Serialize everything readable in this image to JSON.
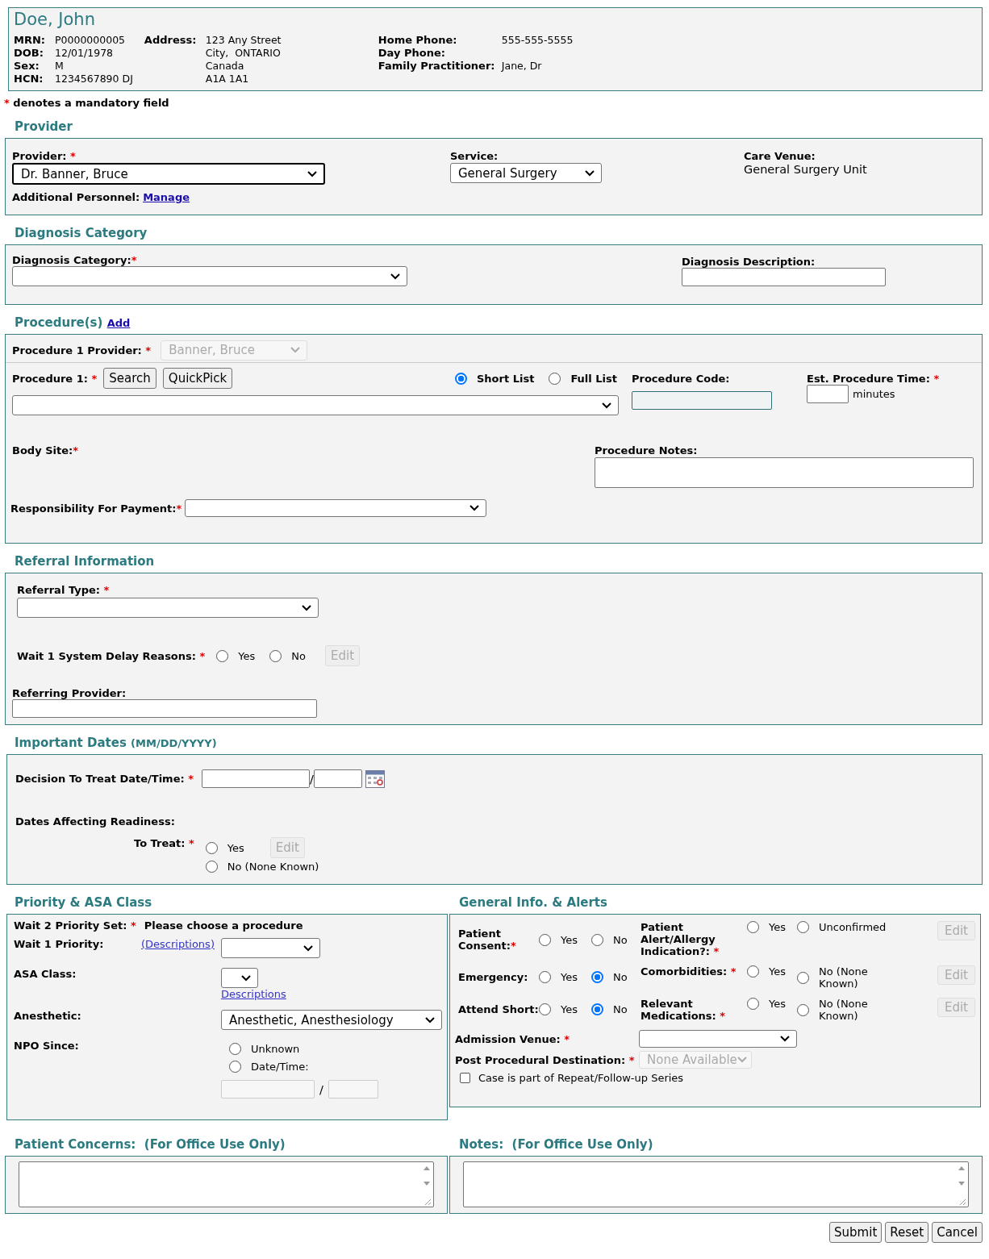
{
  "patient": {
    "name": "Doe, John",
    "left": [
      {
        "label": "MRN:",
        "value": "P0000000005"
      },
      {
        "label": "DOB:",
        "value": "12/01/1978"
      },
      {
        "label": "Sex:",
        "value": "M"
      },
      {
        "label": "HCN:",
        "value": "1234567890 DJ"
      }
    ],
    "address": {
      "label": "Address:",
      "lines": [
        "123 Any Street",
        "City,  ONTARIO",
        "Canada",
        "A1A 1A1"
      ]
    },
    "right": [
      {
        "label": "Home Phone:",
        "value": "555-555-5555"
      },
      {
        "label": "Day Phone:"
      },
      {
        "label": "Family Practitioner:",
        "value": "Jane, Dr"
      }
    ]
  },
  "legend": {
    "mark": "*",
    "text": "denotes a mandatory field"
  },
  "provider": {
    "title": "Provider",
    "provider": {
      "label": "Provider:",
      "mark": "*",
      "value": "Dr. Banner, Bruce"
    },
    "service": {
      "label": "Service:",
      "value": "General Surgery"
    },
    "care_venue": {
      "label": "Care Venue:",
      "value": "General Surgery Unit"
    },
    "personnel": {
      "label": "Additional Personnel:",
      "link": "Manage"
    }
  },
  "diagnosis": {
    "title": "Diagnosis Category",
    "category": {
      "label": "Diagnosis Category:",
      "mark": "*"
    },
    "description": {
      "label": "Diagnosis Description:"
    }
  },
  "procedures": {
    "title": "Procedure(s)",
    "add_link": "Add",
    "provider": {
      "label": "Procedure 1 Provider:",
      "mark": "*",
      "value": "Banner, Bruce",
      "disabled": true
    },
    "procedure": {
      "label": "Procedure 1:",
      "mark": "*",
      "buttons": [
        "Search",
        "QuickPick"
      ]
    },
    "list_options": [
      {
        "label": "Short List",
        "selected": true
      },
      {
        "label": "Full List",
        "selected": false
      }
    ],
    "code": {
      "label": "Procedure Code:"
    },
    "time": {
      "label": "Est. Procedure Time:",
      "mark": "*",
      "unit": "minutes"
    },
    "body_site": {
      "label": "Body Site:",
      "mark": "*"
    },
    "notes": {
      "label": "Procedure Notes:"
    },
    "payment": {
      "label": "Responsibility For Payment:",
      "mark": "*"
    }
  },
  "referral": {
    "title": "Referral Information",
    "type": {
      "label": "Referral Type:",
      "mark": "*"
    },
    "delay": {
      "label": "Wait 1 System Delay Reasons:",
      "mark": "*",
      "options": [
        {
          "label": "Yes",
          "selected": false
        },
        {
          "label": "No",
          "selected": false
        }
      ],
      "button": {
        "label": "Edit",
        "disabled": true
      }
    },
    "referring": {
      "label": "Referring Provider:"
    }
  },
  "dates": {
    "title": "Important Dates",
    "title_note": "(MM/DD/YYYY)",
    "decision": {
      "label": "Decision To Treat Date/Time:",
      "mark": "*",
      "separator": "/"
    },
    "readiness": {
      "label": "Dates Affecting Readiness:"
    },
    "to_treat": {
      "label": "To Treat:",
      "mark": "*",
      "options": [
        {
          "label": "Yes",
          "selected": false
        },
        {
          "label": "No (None Known)",
          "selected": false
        }
      ],
      "button": {
        "label": "Edit",
        "disabled": true
      }
    }
  },
  "priority": {
    "title": "Priority & ASA Class",
    "wait2": {
      "label": "Wait 2 Priority Set:",
      "mark": "*",
      "value": "Please choose a procedure"
    },
    "wait1": {
      "label": "Wait 1 Priority:",
      "link": "(Descriptions)"
    },
    "asa": {
      "label": "ASA Class:",
      "link": "Descriptions"
    },
    "anesthetic": {
      "label": "Anesthetic:",
      "value": "Anesthetic, Anesthesiology"
    },
    "npo": {
      "label": "NPO Since:",
      "options": [
        {
          "label": "Unknown",
          "selected": false
        },
        {
          "label": "Date/Time:",
          "selected": false
        }
      ],
      "separator": "/"
    }
  },
  "general": {
    "title": "General Info. & Alerts",
    "left": [
      {
        "label": "Patient Consent:",
        "mark": "*",
        "options": [
          {
            "label": "Yes",
            "selected": false
          },
          {
            "label": "No",
            "selected": false
          }
        ]
      },
      {
        "label": "Emergency:",
        "options": [
          {
            "label": "Yes",
            "selected": false
          },
          {
            "label": "No",
            "selected": true
          }
        ]
      },
      {
        "label": "Attend Short:",
        "options": [
          {
            "label": "Yes",
            "selected": false
          },
          {
            "label": "No",
            "selected": true
          }
        ]
      }
    ],
    "right": [
      {
        "label": "Patient Alert/Allergy Indication?:",
        "mark": "*",
        "options": [
          {
            "label": "Yes",
            "selected": false
          },
          {
            "label": "Unconfirmed",
            "selected": false
          }
        ],
        "button": {
          "label": "Edit",
          "disabled": true
        }
      },
      {
        "label": "Comorbidities:",
        "mark": "*",
        "options": [
          {
            "label": "Yes",
            "selected": false
          },
          {
            "label": "No (None Known)",
            "selected": false
          }
        ],
        "button": {
          "label": "Edit",
          "disabled": true
        }
      },
      {
        "label": "Relevant Medications:",
        "mark": "*",
        "options": [
          {
            "label": "Yes",
            "selected": false
          },
          {
            "label": "No (None Known)",
            "selected": false
          }
        ],
        "button": {
          "label": "Edit",
          "disabled": true
        }
      }
    ],
    "admission": {
      "label": "Admission Venue:",
      "mark": "*"
    },
    "destination": {
      "label": "Post Procedural Destination:",
      "mark": "*",
      "value": "None Available",
      "disabled": true
    },
    "repeat": {
      "label": "Case is part of Repeat/Follow-up Series",
      "checked": false
    }
  },
  "concerns": {
    "title": "Patient Concerns:",
    "note": "(For Office Use Only)"
  },
  "notes": {
    "title": "Notes:",
    "note": "(For Office Use Only)"
  },
  "actions": [
    "Submit",
    "Reset",
    "Cancel"
  ]
}
